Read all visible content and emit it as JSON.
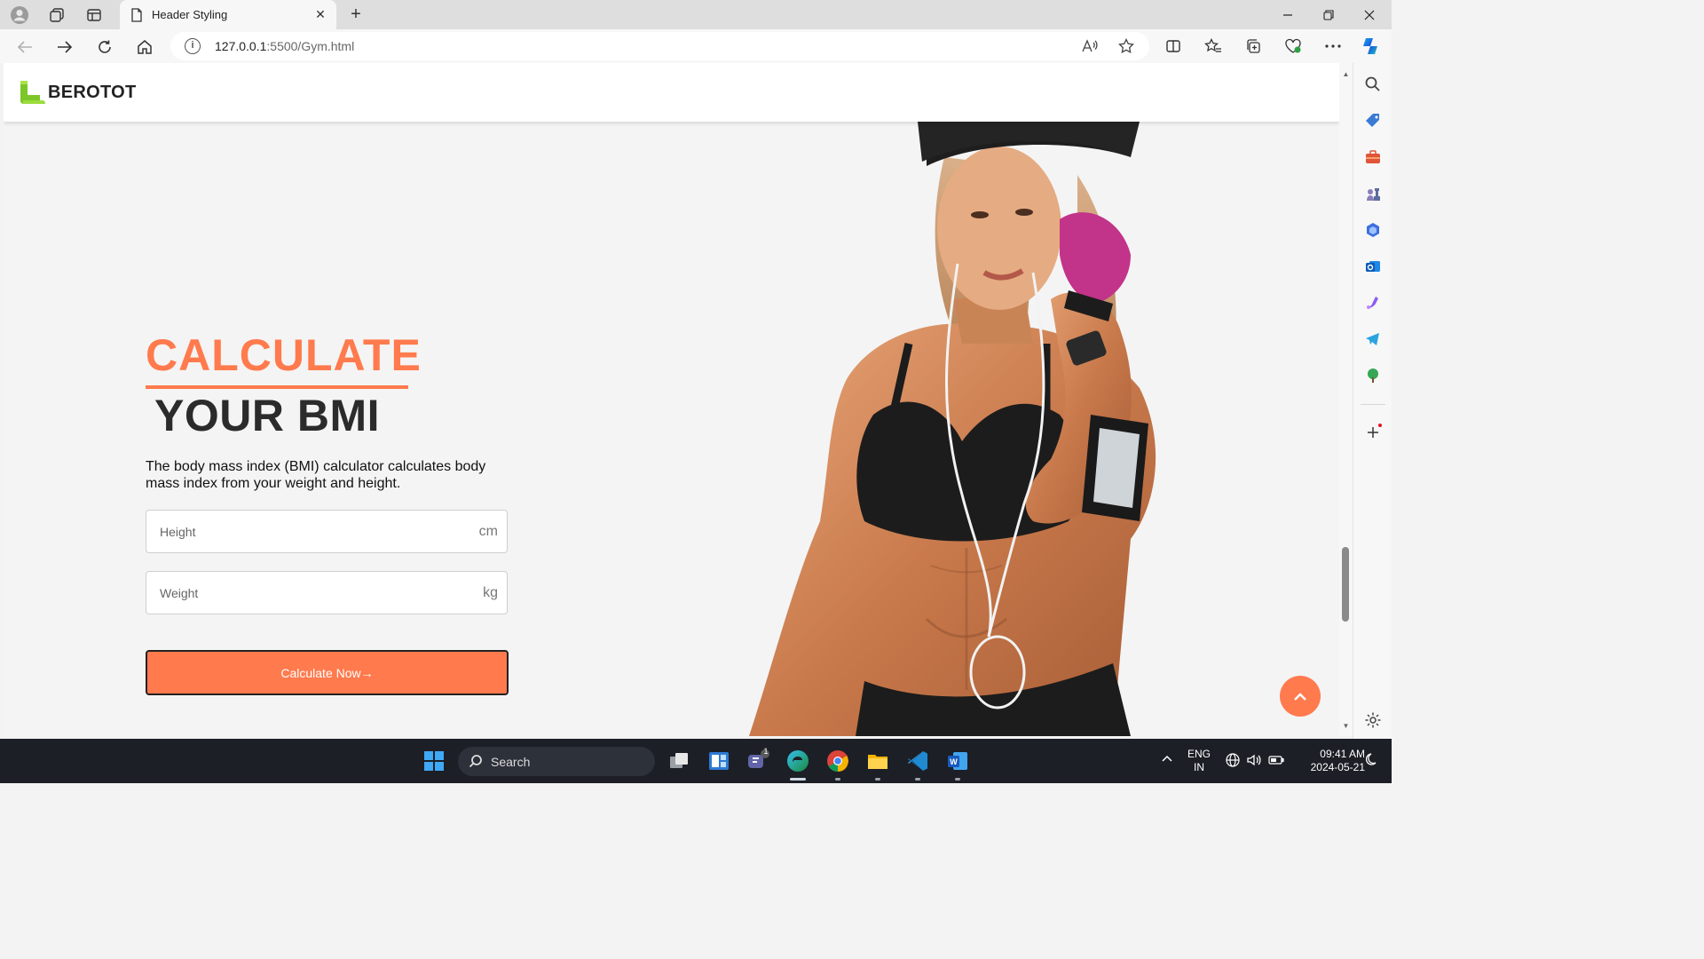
{
  "browser": {
    "tab_title": "Header Styling",
    "url_host": "127.0.0.1",
    "url_path": ":5500/Gym.html"
  },
  "site": {
    "brand": "BEROTOT",
    "hero_title": "CALCULATE",
    "hero_subtitle": "YOUR BMI",
    "description": "The body mass index (BMI) calculator calculates body mass index from your weight and height.",
    "height_placeholder": "Height",
    "height_unit": "cm",
    "weight_placeholder": "Weight",
    "weight_unit": "kg",
    "button_label": "Calculate Now",
    "button_arrow": "→"
  },
  "taskbar": {
    "search_label": "Search",
    "teams_badge": "1",
    "lang_line1": "ENG",
    "lang_line2": "IN",
    "time": "09:41 AM",
    "date": "2024-05-21"
  },
  "colors": {
    "accent": "#ff7a4d",
    "logo_green": "#8bd22f",
    "taskbar": "#1c1f26"
  }
}
